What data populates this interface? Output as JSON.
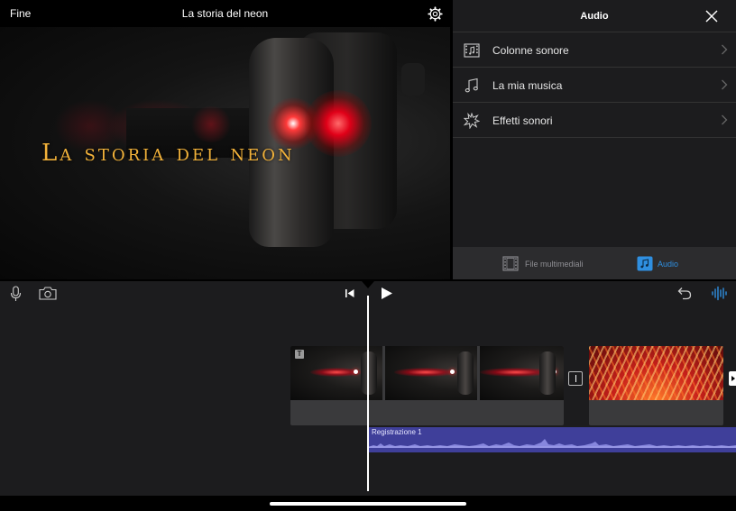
{
  "preview": {
    "done_label": "Fine",
    "project_title": "La storia del neon",
    "video_overlay_title": "La storia del neon"
  },
  "audio_panel": {
    "title": "Audio",
    "items": [
      {
        "label": "Colonne sonore",
        "icon": "film-music-icon"
      },
      {
        "label": "La mia musica",
        "icon": "music-note-icon"
      },
      {
        "label": "Effetti sonori",
        "icon": "sound-effects-icon"
      }
    ],
    "tabs": [
      {
        "label": "File multimediali",
        "icon": "filmstrip-icon",
        "selected": false
      },
      {
        "label": "Audio",
        "icon": "music-note-icon",
        "selected": true
      }
    ]
  },
  "timeline": {
    "audio_clip_label": "Registrazione 1"
  },
  "colors": {
    "panel_bg": "#1c1c1e",
    "accent_blue": "#2f8fe0",
    "audio_clip": "#3f3f9a",
    "title_gold": "#f2b23a"
  }
}
